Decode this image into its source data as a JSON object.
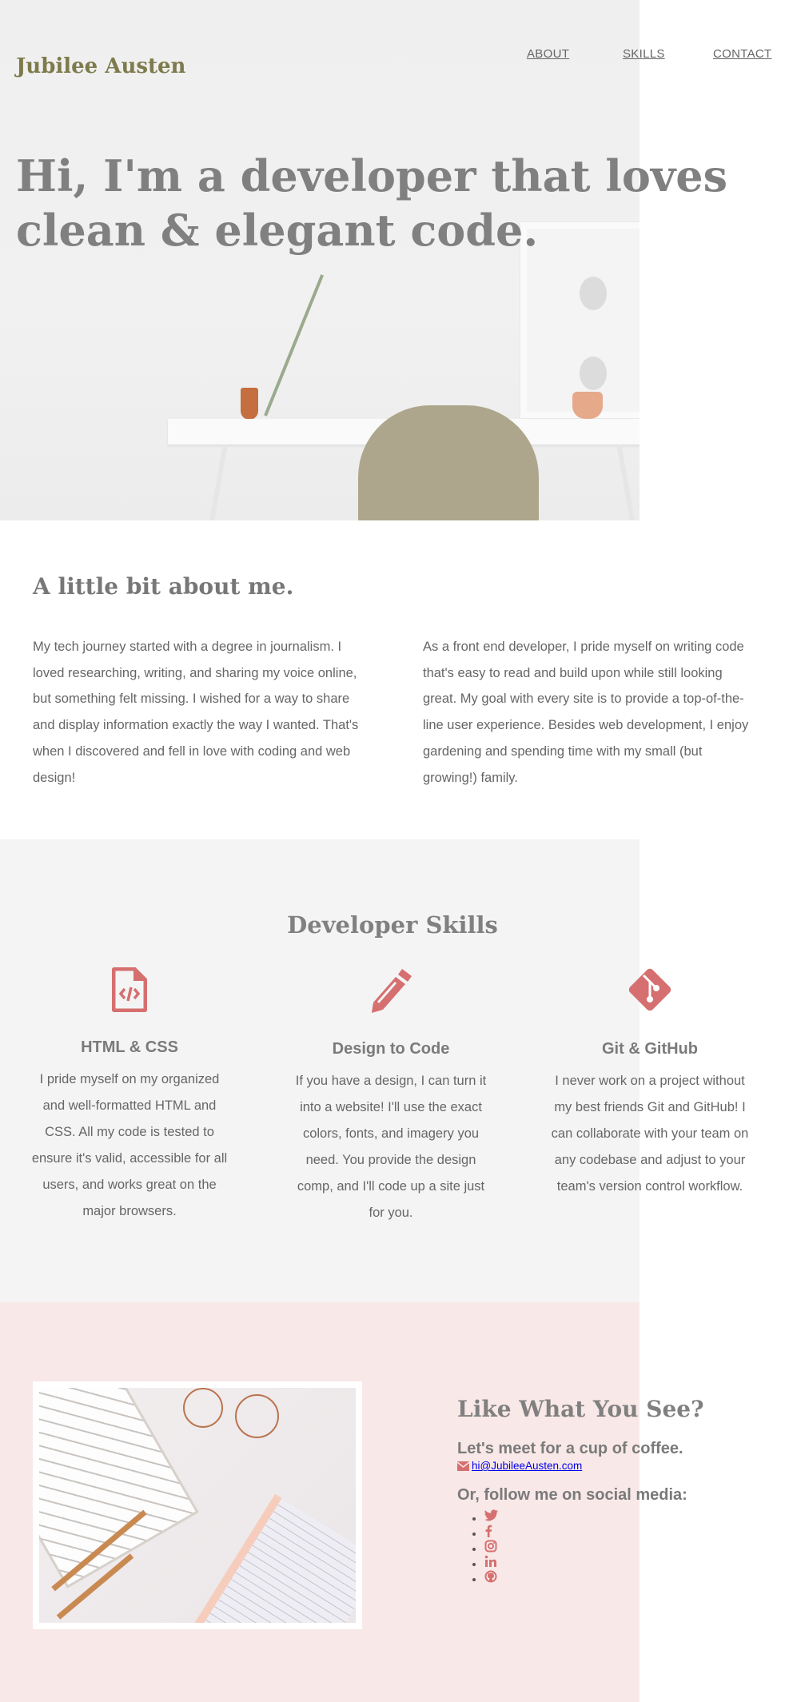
{
  "header": {
    "logo": "Jubilee Austen",
    "nav": [
      {
        "label": "ABOUT"
      },
      {
        "label": "SKILLS"
      },
      {
        "label": "CONTACT"
      }
    ]
  },
  "hero": {
    "headline_line1": "Hi, I'm a developer that loves",
    "headline_line2": "clean & elegant code."
  },
  "about": {
    "title": "A little bit about me.",
    "left": "My tech journey started with a degree in journalism. I loved researching, writing, and sharing my voice online, but something felt missing. I wished for a way to share and display information exactly the way I wanted. That's when I discovered and fell in love with coding and web design!",
    "right": "As a front end developer, I pride myself on writing code that's easy to read and build upon while still looking great. My goal with every site is to provide a top-of-the-line user experience. Besides web development, I enjoy gardening and spending time with my small (but growing!) family."
  },
  "skills": {
    "title": "Developer Skills",
    "items": [
      {
        "icon": "file-code-icon",
        "title": "HTML & CSS",
        "text": "I pride myself on my organized and well-formatted HTML and CSS. All my code is tested to ensure it's valid, accessible for all users, and works great on the major browsers."
      },
      {
        "icon": "pencil-icon",
        "title": "Design to Code",
        "text": "If you have a design, I can turn it into a website! I'll use the exact colors, fonts, and imagery you need. You provide the design comp, and I'll code up a site just for you."
      },
      {
        "icon": "git-icon",
        "title": "Git & GitHub",
        "text": "I never work on a project without my best friends Git and GitHub! I can collaborate with your team on any codebase and adjust to your team's version control workflow."
      }
    ]
  },
  "contact": {
    "title": "Like What You See?",
    "subtitle": "Let's meet for a cup of coffee.",
    "email": "hi@JubileeAusten.com",
    "social_title": "Or, follow me on social media:",
    "social": [
      "twitter-icon",
      "facebook-icon",
      "instagram-icon",
      "linkedin-icon",
      "github-icon"
    ]
  },
  "colors": {
    "accent": "#d66f6f",
    "logo": "#7d7a4c",
    "heading": "#808080",
    "skills_bg": "#f4f4f4",
    "contact_bg": "#f9e8e8"
  }
}
